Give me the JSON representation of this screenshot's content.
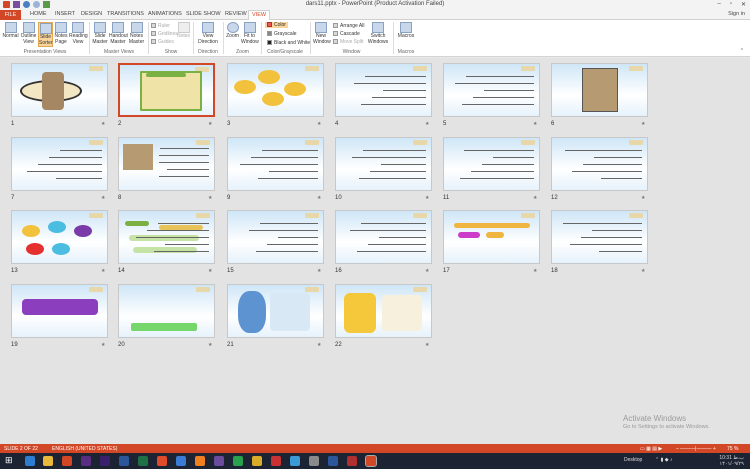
{
  "window": {
    "title": "dars11.pptx - PowerPoint (Product Activation Failed)",
    "sign_in": "Sign in",
    "minimize": "–",
    "restore": "▫",
    "close": "✕"
  },
  "tabs": [
    {
      "label": "FILE"
    },
    {
      "label": "HOME"
    },
    {
      "label": "INSERT"
    },
    {
      "label": "DESIGN"
    },
    {
      "label": "TRANSITIONS"
    },
    {
      "label": "ANIMATIONS"
    },
    {
      "label": "SLIDE SHOW"
    },
    {
      "label": "REVIEW"
    },
    {
      "label": "VIEW"
    }
  ],
  "ribbon": {
    "presentation_views": {
      "label": "Presentation Views",
      "normal": "Normal",
      "outline": "Outline View",
      "slide_sorter": "Slide Sorter",
      "notes": "Notes Page",
      "reading": "Reading View"
    },
    "master_views": {
      "label": "Master Views",
      "slide_master": "Slide Master",
      "handout_master": "Handout Master",
      "notes_master": "Notes Master"
    },
    "show": {
      "label": "Show",
      "ruler": "Ruler",
      "gridlines": "Gridlines",
      "guides": "Guides",
      "notes": "Notes"
    },
    "direction": {
      "label": "Direction",
      "view_direction": "View Direction"
    },
    "zoom": {
      "label": "Zoom",
      "zoom": "Zoom",
      "fit": "Fit to Window"
    },
    "color": {
      "label": "Color/Grayscale",
      "color": "Color",
      "grayscale": "Grayscale",
      "bw": "Black and White"
    },
    "window": {
      "label": "Window",
      "new_window": "New Window",
      "arrange_all": "Arrange All",
      "cascade": "Cascade",
      "move_split": "Move Split",
      "switch": "Switch Windows"
    },
    "macros": {
      "label": "Macros",
      "macros": "Macros"
    }
  },
  "slides": [
    "1",
    "2",
    "3",
    "4",
    "5",
    "6",
    "7",
    "8",
    "9",
    "10",
    "11",
    "12",
    "13",
    "14",
    "15",
    "16",
    "17",
    "18",
    "19",
    "20",
    "21",
    "22"
  ],
  "watermark": {
    "line1": "Activate Windows",
    "line2": "Go to Settings to activate Windows."
  },
  "status": {
    "slide": "SLIDE 2 OF 22",
    "lang": "ENGLISH (UNITED STATES)",
    "zoom": "75 %"
  },
  "taskbar": {
    "desktop": "Desktop",
    "time": "10:31 ب.ظ",
    "date": "۱۴۰۱/۰۹/۲۹"
  },
  "colors": {
    "accent": "#d24726",
    "taskbar": "#1c2333"
  }
}
